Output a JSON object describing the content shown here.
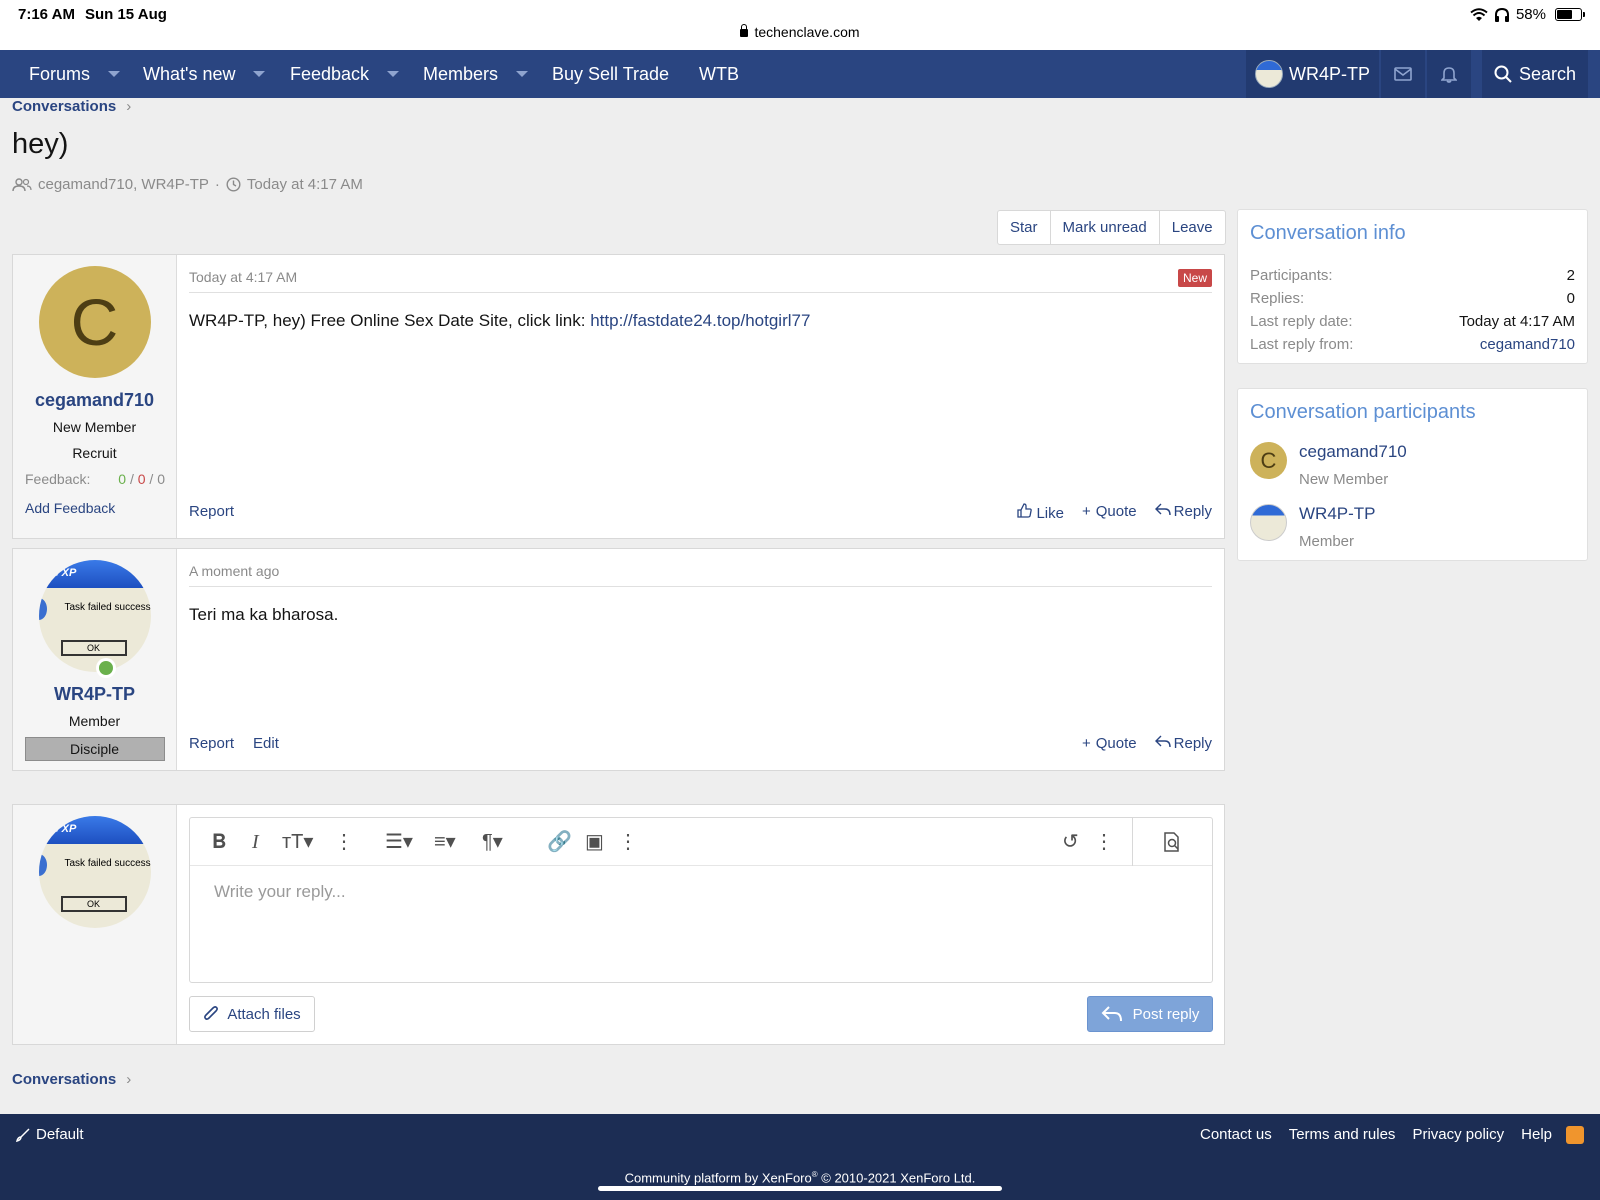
{
  "status": {
    "time": "7:16 AM",
    "date": "Sun 15 Aug",
    "url": "techenclave.com",
    "battery": "58%",
    "battery_level": 0.58
  },
  "nav": {
    "items": [
      "Forums",
      "What's new",
      "Feedback",
      "Members",
      "Buy Sell Trade",
      "WTB"
    ],
    "username": "WR4P-TP",
    "search": "Search"
  },
  "breadcrumb": "Conversations",
  "page": {
    "title": "hey)",
    "participants": "cegamand710, WR4P-TP",
    "time": "Today at 4:17 AM"
  },
  "actions": {
    "star": "Star",
    "mark_unread": "Mark unread",
    "leave": "Leave"
  },
  "messages": [
    {
      "avatar_letter": "C",
      "username": "cegamand710",
      "user_title": "New Member",
      "banner": "Recruit",
      "feedback_label": "Feedback:",
      "feedback_pos": "0",
      "feedback_neg": "0",
      "feedback_neu": "0",
      "sep": "/",
      "add_feedback": "Add Feedback",
      "date": "Today at 4:17 AM",
      "badge": "New",
      "text": "WR4P-TP, hey) Free Online Sex Date Site, click link: ",
      "link": "http://fastdate24.top/hotgirl77",
      "report": "Report",
      "like": "Like",
      "quote": "Quote",
      "reply": "Reply"
    },
    {
      "username": "WR4P-TP",
      "user_title": "Member",
      "banner": "Disciple",
      "avatar_title": "s XP",
      "avatar_text": "Task failed successf",
      "avatar_ok": "OK",
      "date": "A moment ago",
      "text": "Teri ma ka bharosa.",
      "report": "Report",
      "edit": "Edit",
      "quote": "Quote",
      "reply": "Reply"
    }
  ],
  "editor": {
    "placeholder": "Write your reply...",
    "attach": "Attach files",
    "post": "Post reply"
  },
  "info": {
    "title": "Conversation info",
    "rows": [
      {
        "k": "Participants:",
        "v": "2"
      },
      {
        "k": "Replies:",
        "v": "0"
      },
      {
        "k": "Last reply date:",
        "v": "Today at 4:17 AM"
      },
      {
        "k": "Last reply from:",
        "v": "cegamand710"
      }
    ]
  },
  "participants": {
    "title": "Conversation participants",
    "list": [
      {
        "name": "cegamand710",
        "title": "New Member",
        "letter": "C"
      },
      {
        "name": "WR4P-TP",
        "title": "Member"
      }
    ]
  },
  "footer": {
    "style": "Default",
    "links": [
      "Contact us",
      "Terms and rules",
      "Privacy policy",
      "Help"
    ],
    "copyright_pre": "Community platform by XenForo",
    "copyright_reg": "®",
    "copyright_post": " © 2010-2021 XenForo Ltd."
  },
  "colors": {
    "nav": "#2a4581",
    "footer": "#1c2d54",
    "link": "#2a4581",
    "avatar_c": "#cdb25a",
    "new_badge": "#c84848"
  }
}
